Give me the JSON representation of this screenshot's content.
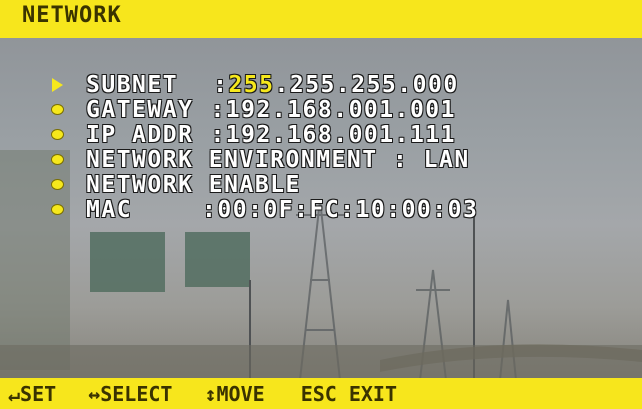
{
  "window": {
    "title": "NETWORK"
  },
  "menu": {
    "items": [
      {
        "label": "SUBNET",
        "separator": ":",
        "value_highlight": "255",
        "value_rest": ".255.255.000",
        "selected": true
      },
      {
        "label": "GATEWAY",
        "separator": ":",
        "value": "192.168.001.001",
        "selected": false
      },
      {
        "label": "IP ADDR",
        "separator": ":",
        "value": "192.168.001.111",
        "selected": false
      },
      {
        "label": "NETWORK ENVIRONMENT : LAN",
        "selected": false
      },
      {
        "label": "NETWORK ENABLE",
        "selected": false
      },
      {
        "label": "MAC",
        "separator": ":",
        "value": "00:0F:FC:10:00:03",
        "selected": false
      }
    ]
  },
  "footer": {
    "set": "↵SET",
    "select": "↔SELECT",
    "move": "↕MOVE",
    "exit": "ESC EXIT"
  },
  "colors": {
    "osd_yellow": "#f7e61c",
    "osd_text": "#ffffff",
    "highlight": "#f6e81c"
  },
  "icons": {
    "selected_marker": "triangle-right-icon",
    "item_marker": "bullet-dot-icon"
  }
}
